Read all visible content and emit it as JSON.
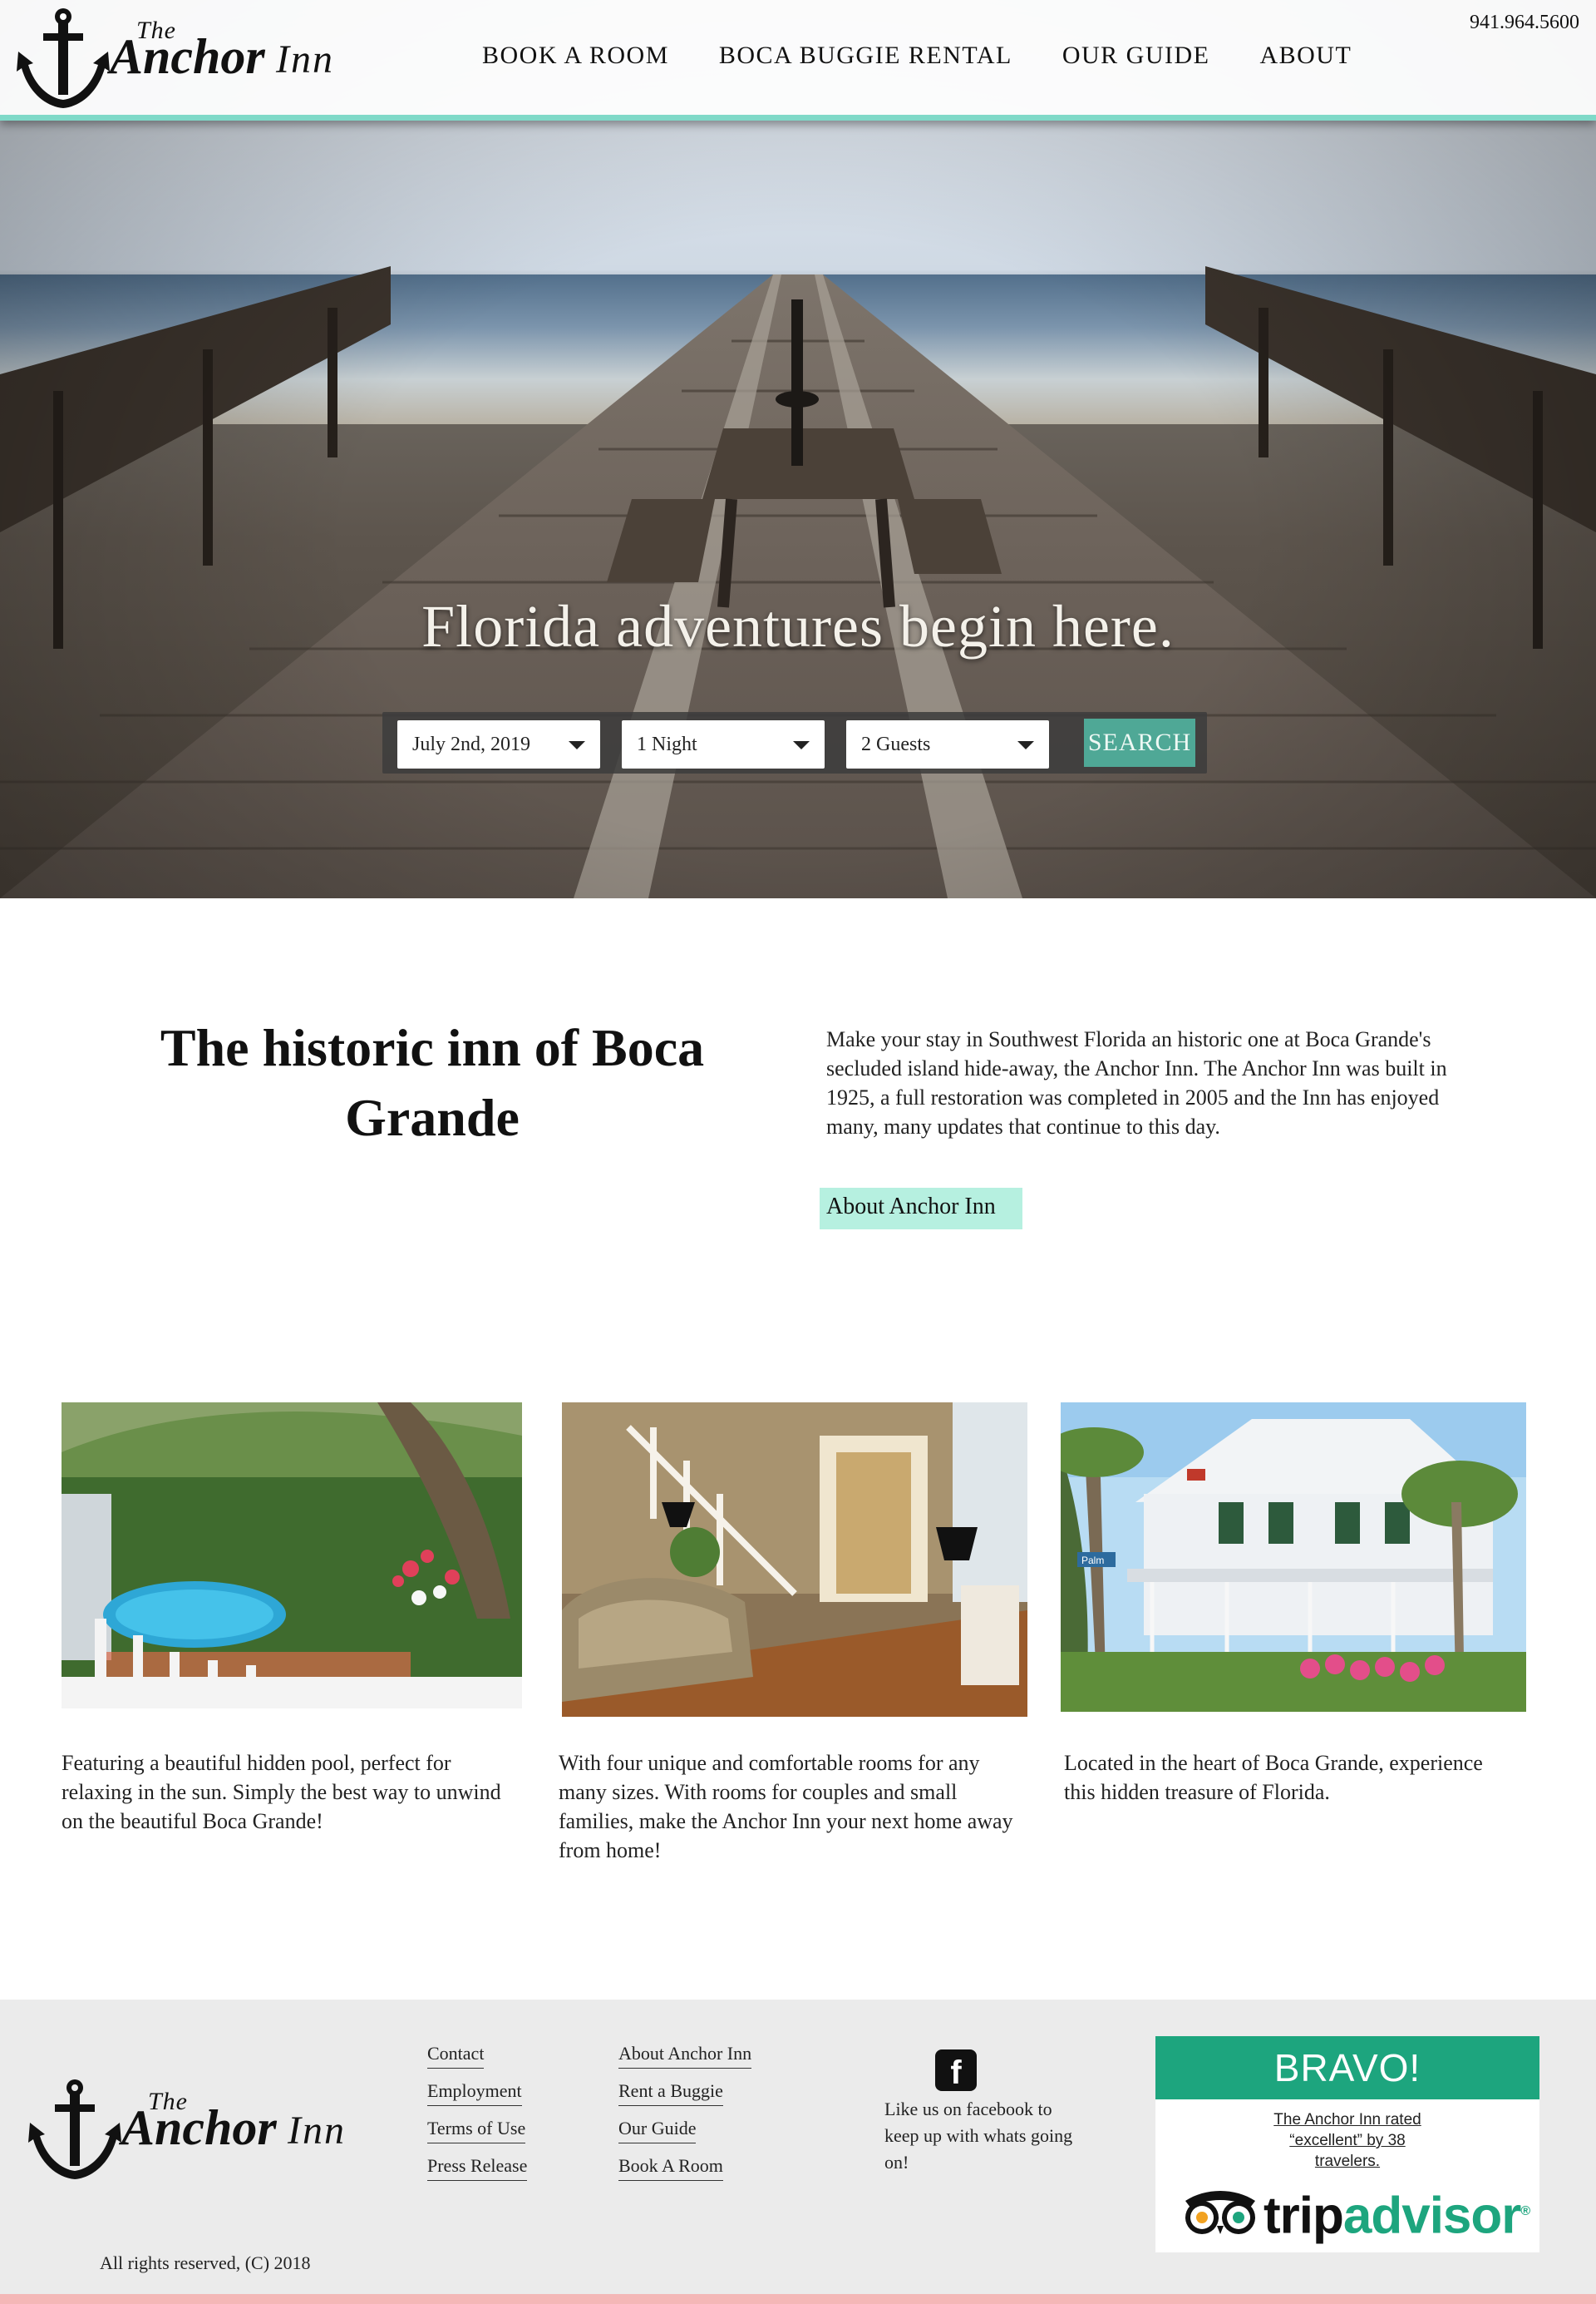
{
  "header": {
    "logo": {
      "the": "The",
      "anchor": "Anchor",
      "inn": "Inn"
    },
    "phone": "941.964.5600",
    "nav": [
      {
        "label": "BOOK A ROOM"
      },
      {
        "label": "BOCA BUGGIE RENTAL"
      },
      {
        "label": "OUR GUIDE"
      },
      {
        "label": "ABOUT"
      }
    ]
  },
  "hero": {
    "title": "Florida adventures begin here.",
    "booking": {
      "date": "July 2nd, 2019",
      "nights": "1 Night",
      "guests": "2 Guests",
      "search_label": "SEARCH"
    }
  },
  "intro": {
    "title": "The historic inn of Boca Grande",
    "text": "Make your stay in Southwest Florida an historic one at Boca Grande's secluded island hide-away, the Anchor Inn. The Anchor Inn was built in 1925, a full restoration was completed in 2005 and the Inn has enjoyed many, many updates that continue to this day.",
    "link_label": "About Anchor Inn"
  },
  "features": [
    {
      "caption": "Featuring a beautiful hidden pool, perfect for relaxing in the sun. Simply the best way to unwind on the beautiful Boca Grande!"
    },
    {
      "caption": "With four unique and comfortable rooms for any many sizes. With rooms for couples and small families, make the Anchor Inn your next home away from home!"
    },
    {
      "caption": "Located in the heart of Boca Grande, experience this hidden treasure of Florida."
    }
  ],
  "photo_signs": {
    "street": "Palm"
  },
  "footer": {
    "logo": {
      "the": "The",
      "anchor": "Anchor",
      "inn": "Inn"
    },
    "col1": [
      {
        "label": "Contact"
      },
      {
        "label": "Employment"
      },
      {
        "label": "Terms of Use"
      },
      {
        "label": "Press Release"
      }
    ],
    "col2": [
      {
        "label": "About Anchor Inn"
      },
      {
        "label": "Rent a Buggie"
      },
      {
        "label": "Our Guide"
      },
      {
        "label": "Book A Room"
      }
    ],
    "facebook": {
      "icon": "facebook-icon",
      "glyph": "f",
      "text": "Like us on facebook to keep up with whats going on!"
    },
    "tripadvisor": {
      "header": "BRAVO!",
      "rated": "The Anchor Inn rated “excellent” by 38 travelers.",
      "trip": "trip",
      "advisor": "advisor",
      "registered": "®"
    },
    "copyright": "All rights reserved, (C) 2018"
  },
  "colors": {
    "accent_teal": "#7fd9c8",
    "search_button": "#4fa896",
    "link_highlight": "#b6f0e0",
    "tripadvisor_green": "#1da57e",
    "footer_bar": "#f4b7b7",
    "footer_bg": "#ebebeb"
  }
}
